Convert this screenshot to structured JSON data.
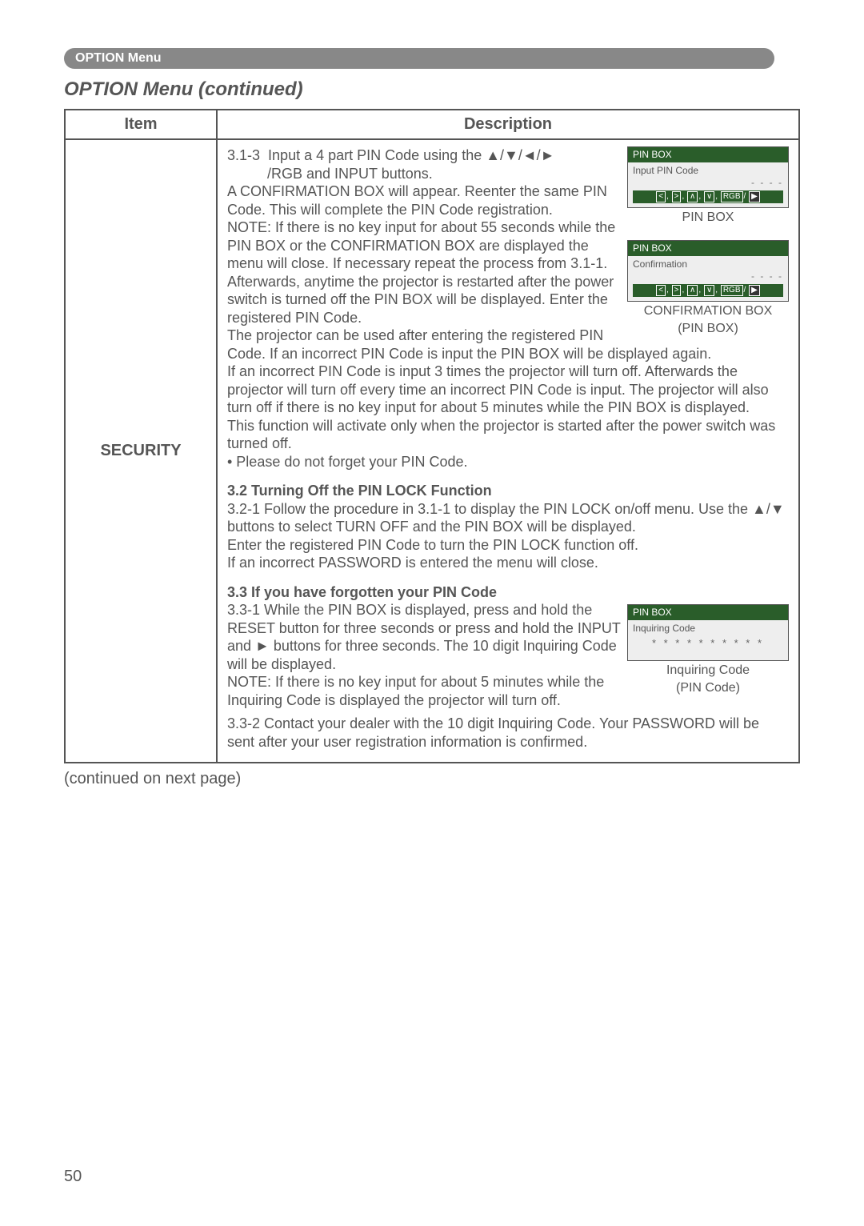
{
  "badge": "OPTION Menu",
  "section_title": "OPTION Menu (continued)",
  "headers": {
    "item": "Item",
    "desc": "Description"
  },
  "row": {
    "item": "SECURITY",
    "p313_label": "3.1-3",
    "p313_a": "Input a 4 part PIN Code using the ▲/▼/◄/►",
    "p313_b": "/RGB and INPUT buttons.",
    "p313_c": "A CONFIRMATION BOX will appear. Reenter the same PIN Code. This will complete the PIN Code registration.",
    "p313_note": "NOTE: If there is no key input for about 55 seconds while the PIN BOX or the CONFIRMATION BOX are displayed the menu will close. If necessary repeat the process from 3.1-1.",
    "p313_d": "Afterwards, anytime the projector is restarted after the power switch is turned off the PIN BOX will be displayed. Enter the registered PIN Code.",
    "p313_e": "The projector can be used after entering the registered PIN Code. If an incorrect PIN Code is input the PIN BOX will be displayed again.",
    "p313_f": "If an incorrect PIN Code is input 3 times the projector will turn off. Afterwards the projector will turn off every time an incorrect PIN Code is input. The projector will also turn off if there is no key input for about 5 minutes while the PIN BOX is displayed.",
    "p313_g": "This function will activate only when the projector is started after the power switch was turned off.",
    "p313_bullet": "• Please do not forget your PIN Code.",
    "h32": "3.2 Turning Off the PIN LOCK Function",
    "p321": "3.2-1 Follow the procedure in 3.1-1 to display the PIN LOCK on/off menu. Use the ▲/▼ buttons to select TURN OFF and the PIN BOX will be displayed.",
    "p32_a": "Enter the registered PIN Code to turn the PIN LOCK function off.",
    "p32_b": "If an incorrect PASSWORD is entered the  menu will close.",
    "h33": "3.3 If you have forgotten your PIN Code",
    "p331_label": "3.3-1",
    "p331_a": "While the PIN BOX is displayed, press and hold the RESET button for three seconds or press and hold the INPUT and ► buttons for three seconds. The 10 digit Inquiring Code will be displayed.",
    "p331_note": "NOTE: If there is no key input for about 5 minutes while the Inquiring Code is displayed the projector will turn off.",
    "p332_label": "3.3-2",
    "p332": "Contact your dealer with the 10 digit Inquiring Code. Your PASSWORD will be sent after your user registration information is confirmed."
  },
  "boxes": {
    "pin_title": "PIN BOX",
    "input_pin": "Input PIN Code",
    "dashes": "- - - -",
    "confirmation": "Confirmation",
    "inquiring": "Inquiring Code",
    "stars": "* *  * * * *  * * * *",
    "key_lt": "<",
    "key_gt": ">",
    "key_up": "∧",
    "key_dn": "∨",
    "key_rgb": "RGB",
    "key_play": "▶",
    "sep": "/",
    "comma": ","
  },
  "captions": {
    "pinbox": "PIN BOX",
    "confbox1": "CONFIRMATION BOX",
    "confbox2": "(PIN BOX)",
    "inq1": "Inquiring Code",
    "inq2": "(PIN Code)"
  },
  "continued": "(continued on next page)",
  "page_num": "50"
}
